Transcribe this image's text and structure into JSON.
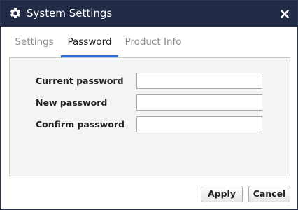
{
  "window": {
    "title": "System Settings",
    "title_icon": "gear-icon",
    "close_icon": "close-icon"
  },
  "tabs": [
    {
      "label": "Settings",
      "active": false
    },
    {
      "label": "Password",
      "active": true
    },
    {
      "label": "Product Info",
      "active": false
    }
  ],
  "form": {
    "fields": [
      {
        "label": "Current password",
        "value": "",
        "placeholder": ""
      },
      {
        "label": "New password",
        "value": "",
        "placeholder": ""
      },
      {
        "label": "Confirm password",
        "value": "",
        "placeholder": ""
      }
    ]
  },
  "footer": {
    "apply_label": "Apply",
    "cancel_label": "Cancel"
  },
  "colors": {
    "titlebar": "#222b45",
    "accent": "#2f6fd6",
    "panel_bg": "#f4f4f4"
  }
}
